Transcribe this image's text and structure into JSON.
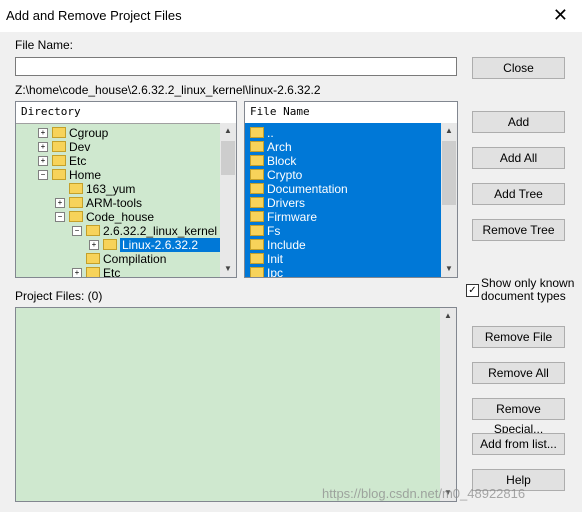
{
  "window": {
    "title": "Add and Remove Project Files",
    "close_glyph": "✕"
  },
  "file_name": {
    "label": "File Name:",
    "value": ""
  },
  "current_path": "Z:\\home\\code_house\\2.6.32.2_linux_kernel\\linux-2.6.32.2",
  "directory_pane": {
    "header": "Directory",
    "items": [
      {
        "label": "Cgroup",
        "expander": "+"
      },
      {
        "label": "Dev",
        "expander": "+"
      },
      {
        "label": "Etc",
        "expander": "+"
      },
      {
        "label": "Home",
        "expander": "-"
      },
      {
        "label": "163_yum",
        "expander": ""
      },
      {
        "label": "ARM-tools",
        "expander": "+"
      },
      {
        "label": "Code_house",
        "expander": "-"
      },
      {
        "label": "2.6.32.2_linux_kernel",
        "expander": "-"
      },
      {
        "label": "Linux-2.6.32.2",
        "expander": "+"
      },
      {
        "label": "Compilation",
        "expander": ""
      },
      {
        "label": "Etc",
        "expander": "+"
      }
    ]
  },
  "file_pane": {
    "header": "File Name",
    "items": [
      "..",
      "Arch",
      "Block",
      "Crypto",
      "Documentation",
      "Drivers",
      "Firmware",
      "Fs",
      "Include",
      "Init",
      "Ipc"
    ]
  },
  "buttons": {
    "close": "Close",
    "add": "Add",
    "add_all": "Add All",
    "add_tree": "Add Tree",
    "remove_tree": "Remove Tree",
    "remove_file": "Remove File",
    "remove_all": "Remove All",
    "remove_special": "Remove Special...",
    "add_from_list": "Add from list...",
    "help": "Help"
  },
  "show_only_known": {
    "line1": "Show only known",
    "line2": "document types",
    "checked": true
  },
  "project_files": {
    "label": "Project Files: (0)"
  },
  "watermark": "https://blog.csdn.net/m0_48922816",
  "colors": {
    "tree_bg": "#cfe8cf",
    "selection": "#0078d7"
  }
}
